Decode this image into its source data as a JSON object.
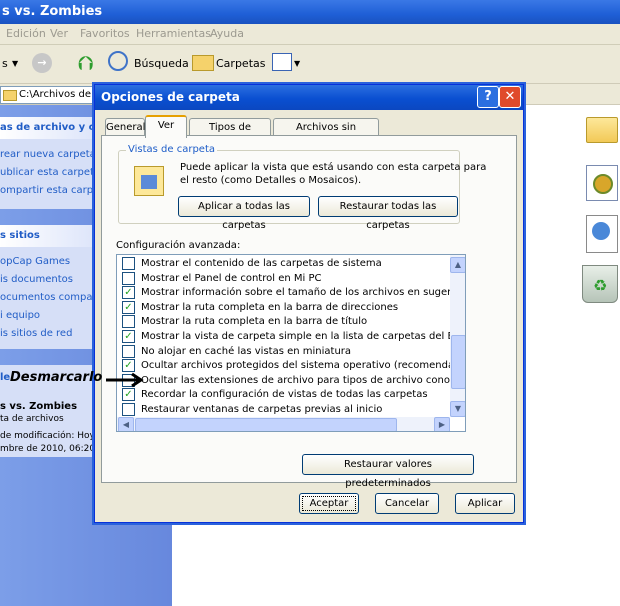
{
  "window": {
    "title": "s vs. Zombies"
  },
  "menu": [
    "Edición",
    "Ver",
    "Favoritos",
    "Herramientas",
    "Ayuda"
  ],
  "toolbar": {
    "back_fragment": "s",
    "search": "Búsqueda",
    "folders": "Carpetas"
  },
  "address": {
    "value": "C:\\Archivos de pr"
  },
  "sidebar": {
    "tasks_header": "as de archivo y car",
    "tasks": [
      "rear nueva carpeta",
      "ublicar esta carpeta e",
      "ompartir esta carpeta"
    ],
    "places_header": "s sitios",
    "places": [
      "opCap Games",
      "is documentos",
      "ocumentos comparti",
      "i equipo",
      "is sitios de red"
    ],
    "annotation_prefix": "le",
    "annotation": "Desmarcarlo",
    "details_title": "s vs. Zombies",
    "details_type": "ta de archivos",
    "details_modified_label": "de modificación: Hoy",
    "details_modified_value": "mbre de 2010, 06:20"
  },
  "dialog": {
    "title": "Opciones de carpeta",
    "help": "?",
    "close": "✕",
    "tabs": [
      "General",
      "Ver",
      "Tipos de archivo",
      "Archivos sin conexión"
    ],
    "views_group": "Vistas de carpeta",
    "views_text_1": "Puede aplicar la vista que está usando con esta carpeta para",
    "views_text_2": "el resto (como Detalles o Mosaicos).",
    "apply_all": "Aplicar a todas las carpetas",
    "reset_all": "Restaurar todas las carpetas",
    "advanced_label": "Configuración avanzada:",
    "settings": [
      {
        "label": "Mostrar el contenido de las carpetas de sistema",
        "checked": false
      },
      {
        "label": "Mostrar el Panel de control en Mi PC",
        "checked": false
      },
      {
        "label": "Mostrar información sobre el tamaño de los archivos en sugerencia",
        "checked": true
      },
      {
        "label": "Mostrar la ruta completa en la barra de direcciones",
        "checked": true
      },
      {
        "label": "Mostrar la ruta completa en la barra de título",
        "checked": false
      },
      {
        "label": "Mostrar la vista de carpeta simple en la lista de carpetas del Explor",
        "checked": true
      },
      {
        "label": "No alojar en caché las vistas en miniatura",
        "checked": false
      },
      {
        "label": "Ocultar archivos protegidos del sistema operativo (recomendado)",
        "checked": true
      },
      {
        "label": "Ocultar las extensiones de archivo para tipos de archivo conocido",
        "checked": false
      },
      {
        "label": "Recordar la configuración de vistas de todas las carpetas",
        "checked": true
      },
      {
        "label": "Restaurar ventanas de carpetas previas al inicio",
        "checked": false
      }
    ],
    "restore_defaults": "Restaurar valores predeterminados",
    "ok": "Aceptar",
    "cancel": "Cancelar",
    "apply": "Aplicar"
  },
  "icons": [
    "folder-icon",
    "setup-file-icon",
    "html-file-icon",
    "recycle-bin-icon"
  ]
}
